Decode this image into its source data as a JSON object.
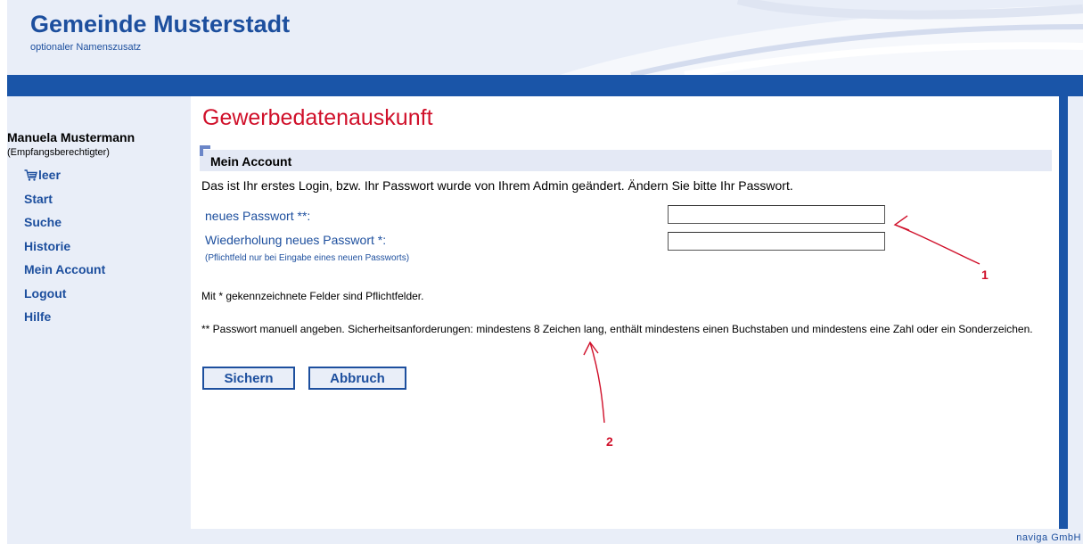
{
  "header": {
    "title": "Gemeinde Musterstadt",
    "subtitle": "optionaler Namenszusatz"
  },
  "sidebar": {
    "user_name": "Manuela Mustermann",
    "user_role": "(Empfangsberechtigter)",
    "cart_label": "leer",
    "items": [
      {
        "label": "Start"
      },
      {
        "label": "Suche"
      },
      {
        "label": "Historie"
      },
      {
        "label": "Mein Account"
      },
      {
        "label": "Logout"
      },
      {
        "label": "Hilfe"
      }
    ]
  },
  "main": {
    "page_title": "Gewerbedatenauskunft",
    "section_title": "Mein Account",
    "intro": "Das ist Ihr erstes Login, bzw. Ihr Passwort wurde von Ihrem Admin geändert. Ändern Sie bitte Ihr Passwort.",
    "fields": {
      "new_password_label": "neues Passwort **:",
      "new_password_value": "",
      "repeat_password_label": "Wiederholung neues Passwort *:",
      "repeat_password_value": "",
      "hint": "(Pflichtfeld nur bei Eingabe eines neuen Passworts)"
    },
    "required_note": "Mit * gekennzeichnete Felder sind Pflichtfelder.",
    "security_note": "** Passwort manuell angeben. Sicherheitsanforderungen: mindestens 8 Zeichen lang, enthält mindestens einen Buchstaben und mindestens eine Zahl oder ein Sonderzeichen.",
    "buttons": {
      "save": "Sichern",
      "cancel": "Abbruch"
    }
  },
  "annotations": {
    "marker_1": "1",
    "marker_2": "2"
  },
  "footer": {
    "credit": "naviga GmbH"
  },
  "colors": {
    "brand_blue": "#1d4f9e",
    "bar_blue": "#1a55a8",
    "title_red": "#d0102a",
    "page_bg": "#e9eef8"
  },
  "icons": {
    "cart": "shopping-cart-icon"
  }
}
